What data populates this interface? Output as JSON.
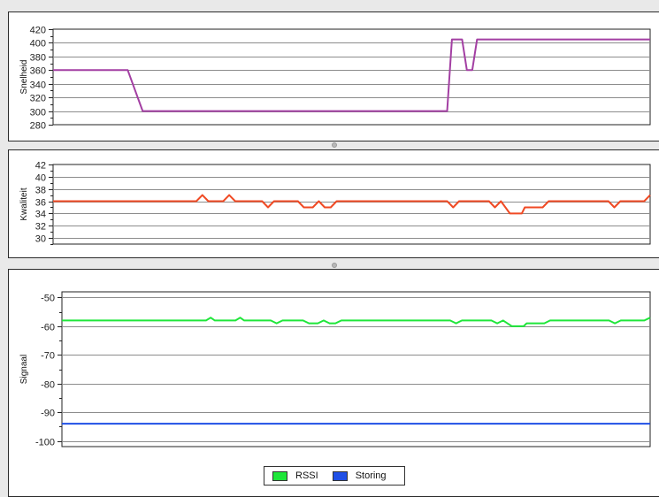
{
  "chart_data": [
    {
      "type": "line",
      "ylabel": "Snelheid",
      "ylim": [
        280,
        420
      ],
      "yticks": [
        280,
        300,
        320,
        340,
        360,
        380,
        400,
        420
      ],
      "grid": true,
      "series": [
        {
          "color": "#a33fa3",
          "x": [
            0,
            12.5,
            15,
            66,
            66.8,
            68.5,
            69.3,
            70.2,
            71.0,
            100
          ],
          "values": [
            360,
            360,
            300,
            300,
            405,
            405,
            360,
            360,
            405,
            405
          ]
        }
      ]
    },
    {
      "type": "line",
      "ylabel": "Kwaliteit",
      "ylim": [
        29,
        42
      ],
      "yticks": [
        30,
        32,
        34,
        36,
        38,
        40,
        42
      ],
      "grid": true,
      "series": [
        {
          "color": "#f04a24",
          "x": [
            0,
            24,
            25,
            26,
            28.5,
            29.5,
            30.5,
            35,
            36,
            37,
            41,
            42,
            43.5,
            44.5,
            45.5,
            46.5,
            47.5,
            66,
            67,
            68,
            73,
            74,
            75,
            76.5,
            77.5,
            78.5,
            79,
            81,
            82,
            83,
            93,
            94,
            95,
            99,
            100
          ],
          "values": [
            36,
            36,
            37,
            36,
            36,
            37,
            36,
            36,
            35,
            36,
            36,
            35,
            35,
            36,
            35,
            35,
            36,
            36,
            35,
            36,
            36,
            35,
            36,
            34,
            34,
            34,
            35,
            35,
            35,
            36,
            36,
            35,
            36,
            36,
            37
          ]
        }
      ]
    },
    {
      "type": "line",
      "ylabel": "Signaal",
      "ylim": [
        -102,
        -48
      ],
      "yticks": [
        -50,
        -60,
        -70,
        -80,
        -90,
        -100
      ],
      "grid": true,
      "legend": "bottom-center",
      "series": [
        {
          "name": "RSSI",
          "color": "#1fe63a",
          "x": [
            0,
            24.5,
            25.3,
            26,
            29.5,
            30.3,
            31,
            35.5,
            36.5,
            37.5,
            41,
            42,
            43.5,
            44.5,
            45.5,
            46.5,
            47.5,
            66,
            67,
            68,
            73,
            74,
            75,
            76.5,
            77.5,
            78.5,
            79,
            81,
            82,
            83,
            93,
            94,
            95,
            99,
            100
          ],
          "values": [
            -58,
            -58,
            -57,
            -58,
            -58,
            -57,
            -58,
            -58,
            -59,
            -58,
            -58,
            -59,
            -59,
            -58,
            -59,
            -59,
            -58,
            -58,
            -59,
            -58,
            -58,
            -59,
            -58,
            -60,
            -60,
            -60,
            -59,
            -59,
            -59,
            -58,
            -58,
            -59,
            -58,
            -58,
            -57
          ]
        },
        {
          "name": "Storing",
          "color": "#1f4fe6",
          "x": [
            0,
            100
          ],
          "values": [
            -94,
            -94
          ]
        }
      ]
    }
  ]
}
